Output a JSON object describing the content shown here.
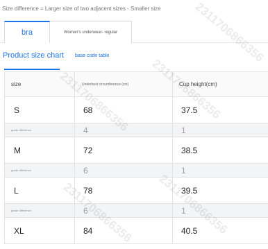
{
  "note": "Size difference = Larger size of two adjacent sizes - Smaller size",
  "tabs": [
    {
      "label": "bra"
    },
    {
      "label": "Women's underwear- regular"
    }
  ],
  "sub_tabs": [
    {
      "label": "Product size chart"
    },
    {
      "label": "base code table"
    }
  ],
  "table": {
    "headers": [
      "size",
      "Underbust circumference (cm)",
      "Cup height(cm)"
    ],
    "rows": [
      {
        "type": "size",
        "cells": [
          "S",
          "68",
          "37.5"
        ]
      },
      {
        "type": "diff",
        "cells": [
          "grade difference",
          "4",
          "1"
        ]
      },
      {
        "type": "size",
        "cells": [
          "M",
          "72",
          "38.5"
        ]
      },
      {
        "type": "diff",
        "cells": [
          "grade difference",
          "6",
          "1"
        ]
      },
      {
        "type": "size",
        "cells": [
          "L",
          "78",
          "39.5"
        ]
      },
      {
        "type": "diff",
        "cells": [
          "grade difference",
          "6",
          "1"
        ]
      },
      {
        "type": "size",
        "cells": [
          "XL",
          "84",
          "40.5"
        ]
      }
    ]
  },
  "watermark": "2311706866356",
  "colors": {
    "accent": "#1a73e8",
    "diff_row_bg": "#f3f4f6",
    "border": "#e2e2e2"
  }
}
